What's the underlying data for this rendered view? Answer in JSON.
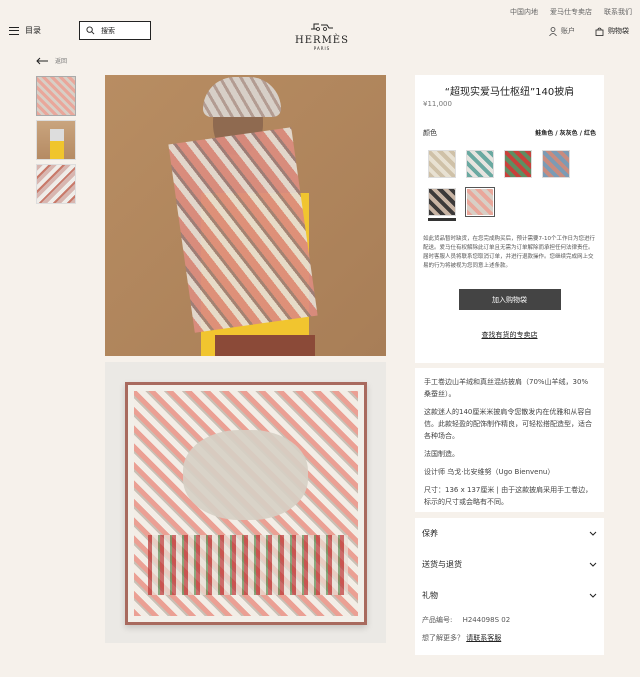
{
  "header": {
    "toplinks": [
      "中国内地",
      "爱马仕专卖店",
      "联系我们"
    ],
    "menu_label": "目录",
    "search_placeholder": "搜索",
    "logo": "HERMÈS",
    "logo_sub": "PARIS",
    "account_label": "账户",
    "bag_label": "购物袋"
  },
  "nav": {
    "back_label": "返回"
  },
  "product": {
    "title": "“超现实爱马仕枢纽”140披肩",
    "price": "¥11,000",
    "color_label": "颜色",
    "selected_color": "鲑鱼色 / 灰灰色 / 红色",
    "notice": "如此货品暂时缺货，在您完成购买后，预计需要7-10个工作日为您进行配送。爱马仕有权解除此订单且无需为订单解除而承担任何法律责任。届时客服人员将联系您取消订单，并进行退款操作。您继续完成网上交易的行为将被视为您同意上述条款。",
    "add_to_cart": "加入购物袋",
    "find_store": "查找有货的专卖店"
  },
  "description": {
    "material": "手工卷边山羊绒和真丝混纺披肩（70%山羊绒，30%桑蚕丝）。",
    "story": "这款迷人的140厘米米披肩令您散发内在优雅和从容自信。此款轻盈的配饰制作精良，可轻松搭配造型，适合各种场合。",
    "origin": "法国制造。",
    "designer": "设计师 乌戈·比安维努（Ugo Bienvenu）",
    "size": "尺寸：136 x 137厘米 | 由于这款披肩采用手工卷边，标示的尺寸或会略有不同。"
  },
  "accordion": [
    "保养",
    "送货与退货",
    "礼物"
  ],
  "meta": {
    "code_label": "产品编号:",
    "code_value": "H244098S 02",
    "more_label": "想了解更多？",
    "contact_link": "请联系客服"
  }
}
